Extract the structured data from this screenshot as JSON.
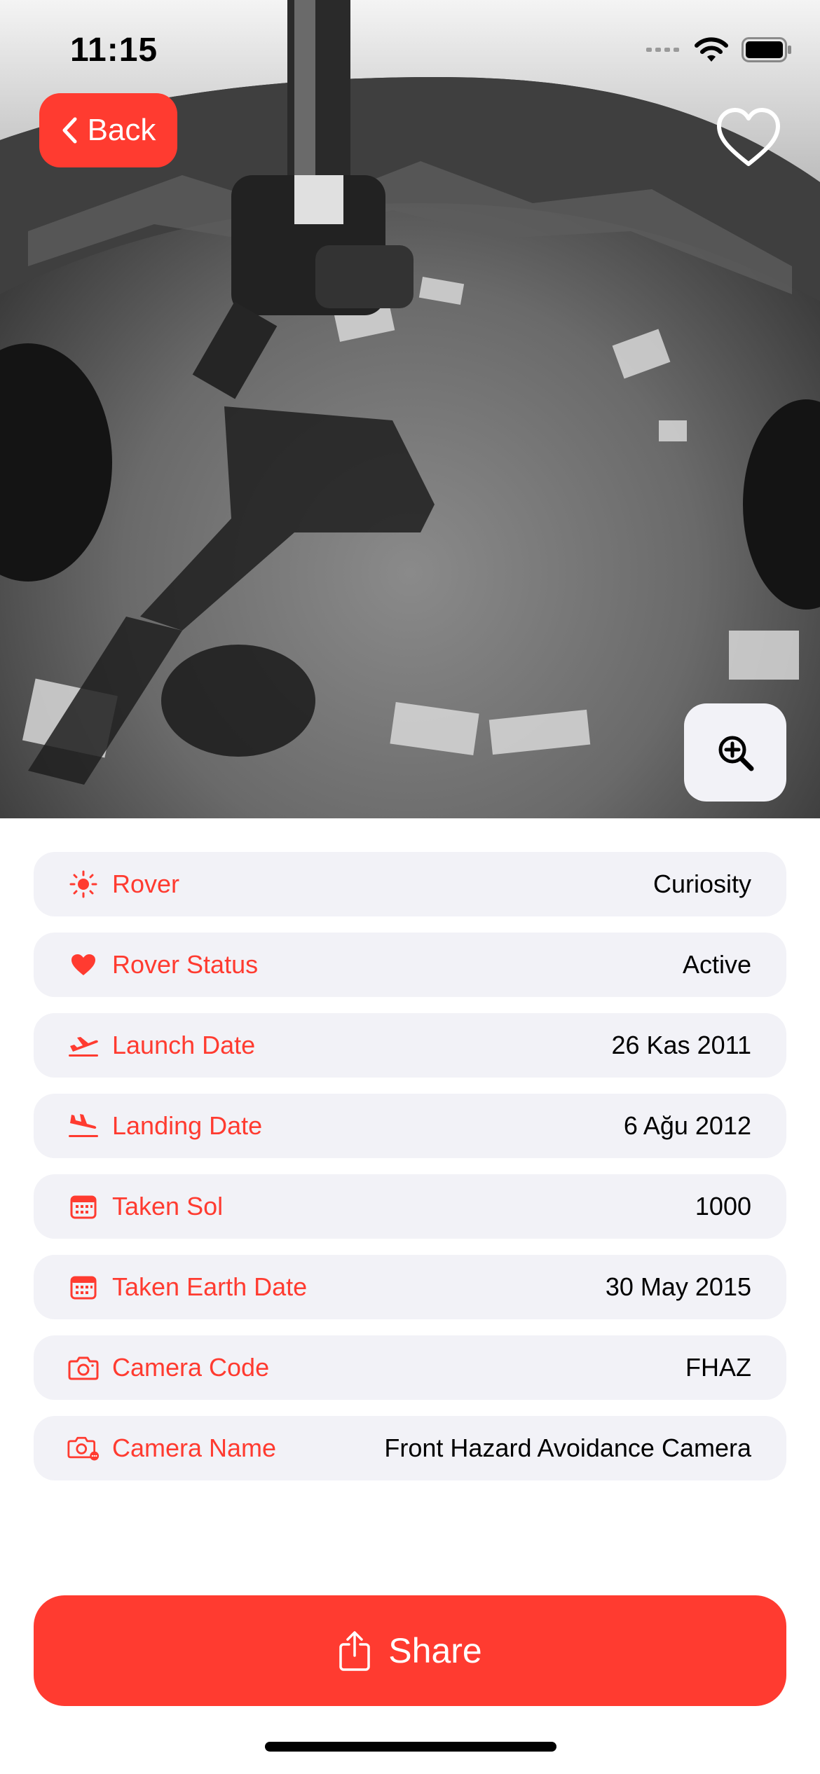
{
  "status_bar": {
    "time": "11:15"
  },
  "nav": {
    "back_label": "Back"
  },
  "photo": {
    "description_icon": "mars-rover-photo"
  },
  "details": [
    {
      "icon": "sun-icon",
      "label": "Rover",
      "value": "Curiosity"
    },
    {
      "icon": "heart-icon",
      "label": "Rover Status",
      "value": "Active"
    },
    {
      "icon": "airplane-departure-icon",
      "label": "Launch Date",
      "value": "26 Kas 2011"
    },
    {
      "icon": "airplane-arrival-icon",
      "label": "Landing Date",
      "value": "6 Ağu 2012"
    },
    {
      "icon": "calendar-icon",
      "label": "Taken Sol",
      "value": "1000"
    },
    {
      "icon": "calendar-icon",
      "label": "Taken Earth Date",
      "value": "30 May 2015"
    },
    {
      "icon": "camera-icon",
      "label": "Camera Code",
      "value": "FHAZ"
    },
    {
      "icon": "camera-badge-icon",
      "label": "Camera Name",
      "value": "Front Hazard Avoidance Camera"
    }
  ],
  "actions": {
    "share_label": "Share"
  },
  "colors": {
    "accent": "#ff3b30",
    "row_bg": "#f2f2f7"
  }
}
